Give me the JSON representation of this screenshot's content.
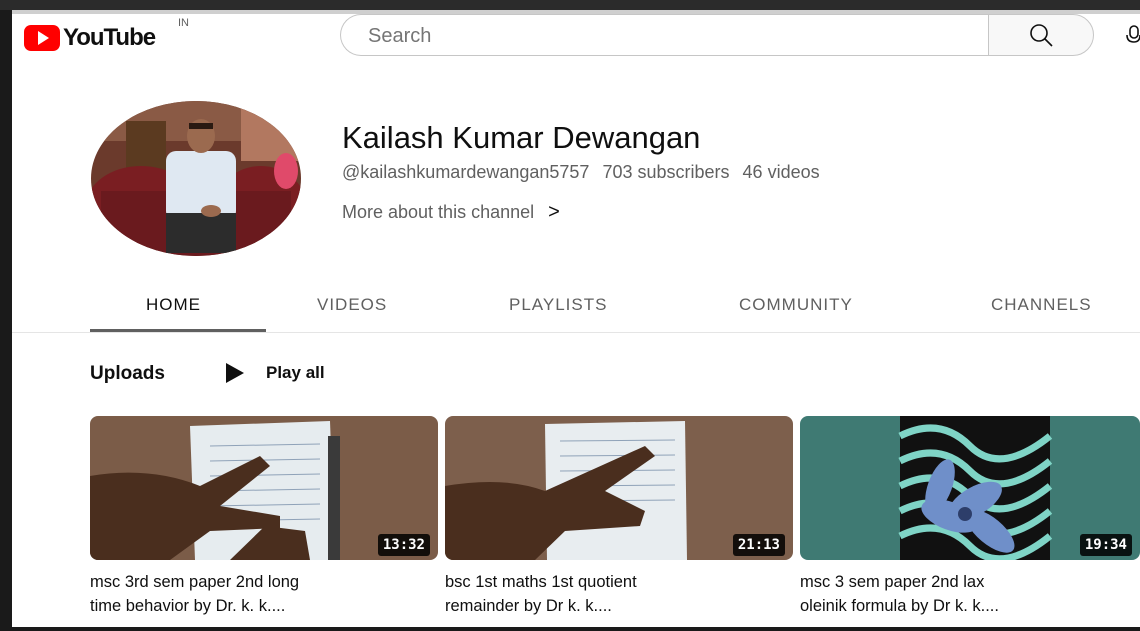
{
  "header": {
    "logo_text": "YouTube",
    "region": "IN",
    "search_placeholder": "Search"
  },
  "channel": {
    "name": "Kailash Kumar Dewangan",
    "handle": "@kailashkumardewangan5757",
    "subscribers": "703 subscribers",
    "videos": "46 videos",
    "more_about": "More about this channel",
    "more_chevron": ">"
  },
  "tabs": [
    {
      "label": "HOME",
      "active": true
    },
    {
      "label": "VIDEOS",
      "active": false
    },
    {
      "label": "PLAYLISTS",
      "active": false
    },
    {
      "label": "COMMUNITY",
      "active": false
    },
    {
      "label": "CHANNELS",
      "active": false
    }
  ],
  "section": {
    "title": "Uploads",
    "play_all": "Play all"
  },
  "videos": [
    {
      "title_line1": "msc 3rd sem paper 2nd long",
      "title_line2": "time behavior by Dr. k. k....",
      "duration": "13:32"
    },
    {
      "title_line1": "bsc 1st maths 1st quotient",
      "title_line2": "remainder by Dr k. k....",
      "duration": "21:13"
    },
    {
      "title_line1": "msc 3 sem paper 2nd lax",
      "title_line2": "oleinik formula by Dr k. k....",
      "duration": "19:34"
    }
  ],
  "colors": {
    "brand_red": "#ff0000",
    "text_primary": "#0f0f0f",
    "text_secondary": "#606060"
  }
}
